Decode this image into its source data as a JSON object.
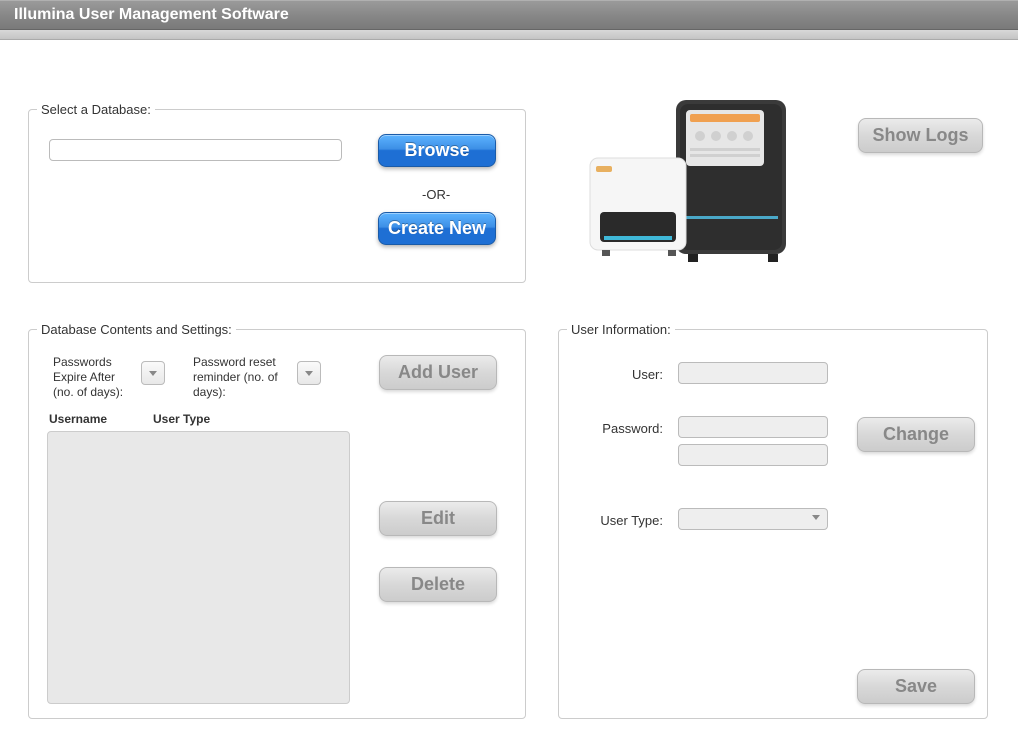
{
  "app_title": "Illumina User Management Software",
  "select_db": {
    "legend": "Select a Database:",
    "path": "",
    "browse_label": "Browse",
    "or_text": "-OR-",
    "create_new_label": "Create New"
  },
  "show_logs_label": "Show Logs",
  "db_contents": {
    "legend": "Database Contents and Settings:",
    "passwords_expire_label": "Passwords Expire After (no. of days):",
    "password_reset_label": "Password reset reminder (no. of days):",
    "passwords_expire_value": "",
    "password_reset_value": "",
    "add_user_label": "Add User",
    "col_username": "Username",
    "col_usertype": "User Type",
    "users": [],
    "edit_label": "Edit",
    "delete_label": "Delete"
  },
  "user_info": {
    "legend": "User Information:",
    "user_label": "User:",
    "user_value": "",
    "password_label": "Password:",
    "password_value": "",
    "password_confirm_value": "",
    "usertype_label": "User Type:",
    "usertype_value": "",
    "change_label": "Change",
    "save_label": "Save"
  }
}
